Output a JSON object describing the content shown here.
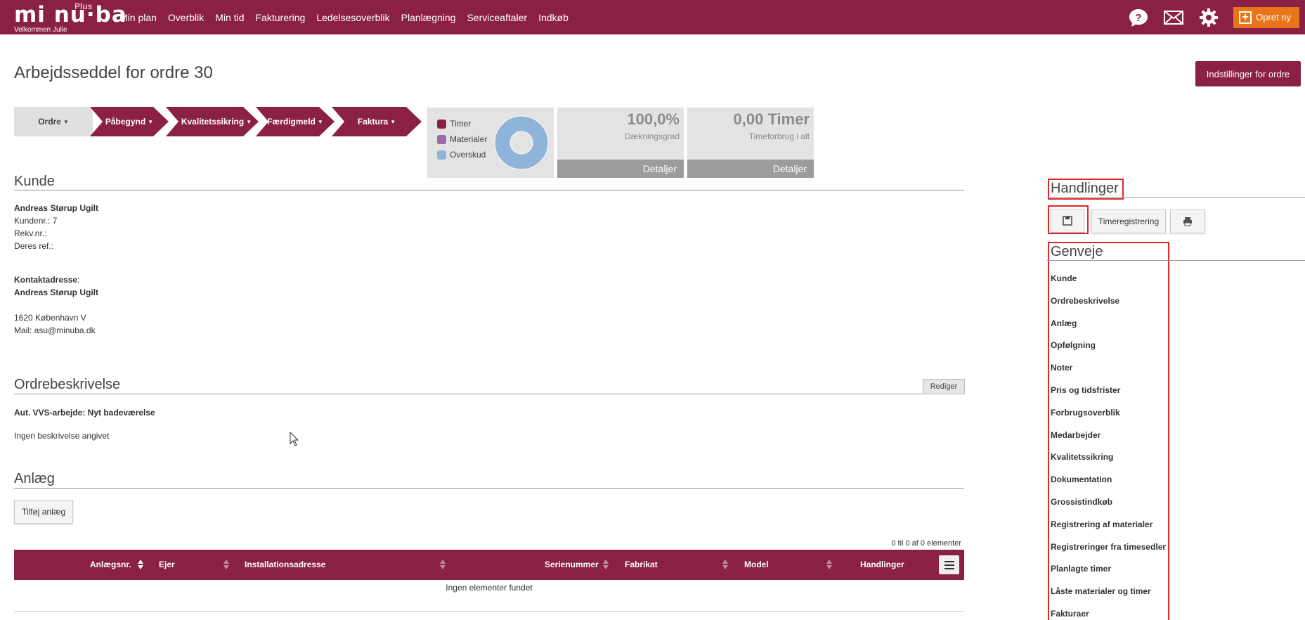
{
  "app": {
    "logo_text": "mi nu·ba",
    "logo_plus": "Plus",
    "welcome": "Velkommen  Julie",
    "brand_color": "#8a2043",
    "accent_color": "#e8751a"
  },
  "nav": {
    "items": [
      "Min plan",
      "Overblik",
      "Min tid",
      "Fakturering",
      "Ledelsesoverblik",
      "Planlægning",
      "Serviceaftaler",
      "Indkøb"
    ],
    "icons": [
      "help-icon",
      "mail-icon",
      "gear-icon"
    ],
    "create_label": "Opret ny"
  },
  "page": {
    "title": "Arbejdsseddel for ordre 30",
    "settings_label": "Indstillinger for ordre"
  },
  "steps": [
    "Ordre",
    "Påbegynd",
    "Kvalitetssikring",
    "Færdigmeld",
    "Faktura"
  ],
  "chart_data": {
    "type": "pie",
    "title": "",
    "legend": [
      "Timer",
      "Materialer",
      "Overskud"
    ],
    "colors": [
      "#8a2043",
      "#9b6aa8",
      "#8fb4d9"
    ],
    "values": [
      0,
      0,
      100
    ]
  },
  "kpis": [
    {
      "value": "100,0%",
      "label": "Dækningsgrad",
      "footer": "Detaljer"
    },
    {
      "value": "0,00 Timer",
      "label": "Timeforbrug i alt",
      "footer": "Detaljer"
    }
  ],
  "customer": {
    "heading": "Kunde",
    "name": "Andreas Størup Ugilt",
    "customer_no": "Kundenr.: 7",
    "rekv": "Rekv.nr.:",
    "ref": "Deres ref.:",
    "contact_label": "Kontaktadresse",
    "contact_name": "Andreas Størup Ugilt",
    "city": "1620   København V",
    "mail": "Mail: asu@minuba.dk"
  },
  "description": {
    "heading": "Ordrebeskrivelse",
    "edit_label": "Rediger",
    "title": "Aut. VVS-arbejde: Nyt badeværelse",
    "body": "Ingen beskrivelse angivet"
  },
  "installations": {
    "heading": "Anlæg",
    "add_label": "Tilføj anlæg",
    "count_text": "0 til 0 af 0 elementer",
    "columns": [
      "Anlægsnr.",
      "Ejer",
      "Installationsadresse",
      "Serienummer",
      "Fabrikat",
      "Model",
      "Handlinger"
    ],
    "empty_text": "Ingen elementer fundet"
  },
  "actions": {
    "heading": "Handlinger",
    "timereg_label": "Timeregistrering"
  },
  "shortcuts": {
    "heading": "Genveje",
    "items": [
      "Kunde",
      "Ordrebeskrivelse",
      "Anlæg",
      "Opfølgning",
      "Noter",
      "Pris og tidsfrister",
      "Forbrugsoverblik",
      "Medarbejder",
      "Kvalitetssikring",
      "Dokumentation",
      "Grossistindkøb",
      "Registrering af materialer",
      "Registreringer fra timesedler",
      "Planlagte timer",
      "Låste materialer og timer",
      "Fakturaer"
    ]
  }
}
